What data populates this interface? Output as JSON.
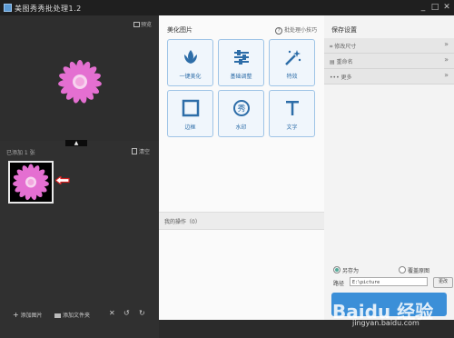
{
  "window": {
    "title": "美图秀秀批处理1.2",
    "controls": [
      "_",
      "□",
      "✕"
    ]
  },
  "left": {
    "preview_label": "预览",
    "collapse_glyph": "▲",
    "added_count": "已添加 1 张",
    "clear_label": "清空",
    "bottom": {
      "add_image": "添加图片",
      "add_folder": "添加文件夹"
    }
  },
  "middle": {
    "title": "美化图片",
    "help_link": "批处理小技巧",
    "tools": [
      {
        "label": "一键美化",
        "icon": "lotus-icon"
      },
      {
        "label": "基础调整",
        "icon": "sliders-icon"
      },
      {
        "label": "特效",
        "icon": "magic-wand-icon"
      },
      {
        "label": "边框",
        "icon": "frame-icon"
      },
      {
        "label": "水印",
        "icon": "watermark-icon"
      },
      {
        "label": "文字",
        "icon": "text-icon"
      }
    ],
    "ops_label": "我的操作（0）"
  },
  "right": {
    "title": "保存设置",
    "sections": [
      {
        "label": "修改尺寸",
        "chevron": "»"
      },
      {
        "label": "重命名",
        "chevron": "»"
      },
      {
        "label": "更多",
        "chevron": "»"
      }
    ],
    "save_as_label": "另存为",
    "overwrite_label": "覆盖原图",
    "path_label": "路径",
    "path_value": "E:\\picture",
    "change_label": "更改"
  },
  "watermark": {
    "brand": "Baidu 经验",
    "url": "jingyan.baidu.com"
  },
  "colors": {
    "accent": "#3b8fd8",
    "tool_border": "#9fc4e6",
    "flower": "#e46fd1"
  }
}
